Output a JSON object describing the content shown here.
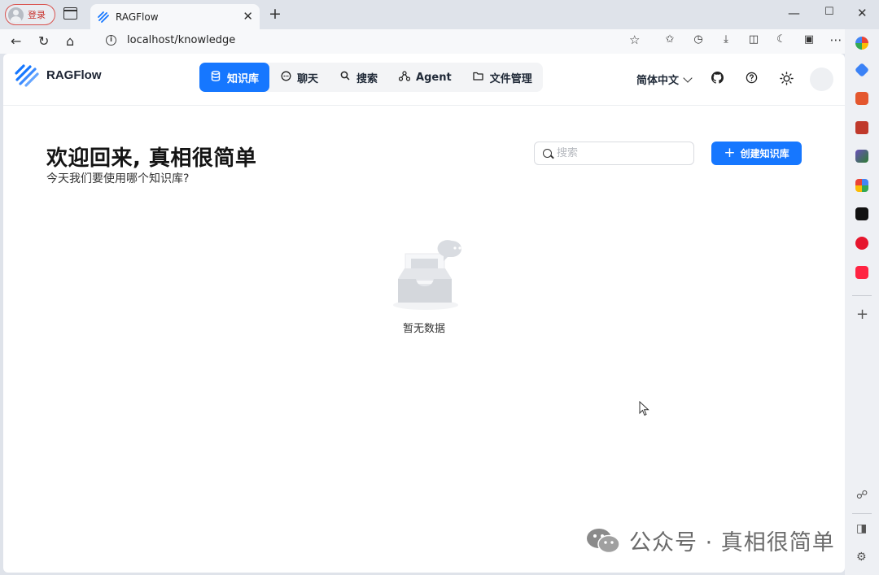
{
  "browser": {
    "profile_label": "登录",
    "tab_title": "RAGFlow",
    "url": "localhost/knowledge"
  },
  "app": {
    "brand": "RAGFlow",
    "nav": [
      {
        "label": "知识库",
        "icon": "database-icon",
        "active": true
      },
      {
        "label": "聊天",
        "icon": "chat-icon",
        "active": false
      },
      {
        "label": "搜索",
        "icon": "search-icon",
        "active": false
      },
      {
        "label": "Agent",
        "icon": "agent-graph-icon",
        "active": false
      },
      {
        "label": "文件管理",
        "icon": "folder-icon",
        "active": false
      }
    ],
    "language": "简体中文"
  },
  "main": {
    "title": "欢迎回来, 真相很简单",
    "subtitle": "今天我们要使用哪个知识库?",
    "search_placeholder": "搜索",
    "create_label": "创建知识库",
    "empty_text": "暂无数据"
  },
  "watermark": {
    "text": "公众号 · 真相很简单"
  },
  "colors": {
    "primary": "#1677ff",
    "profile_border": "#d9534f"
  }
}
